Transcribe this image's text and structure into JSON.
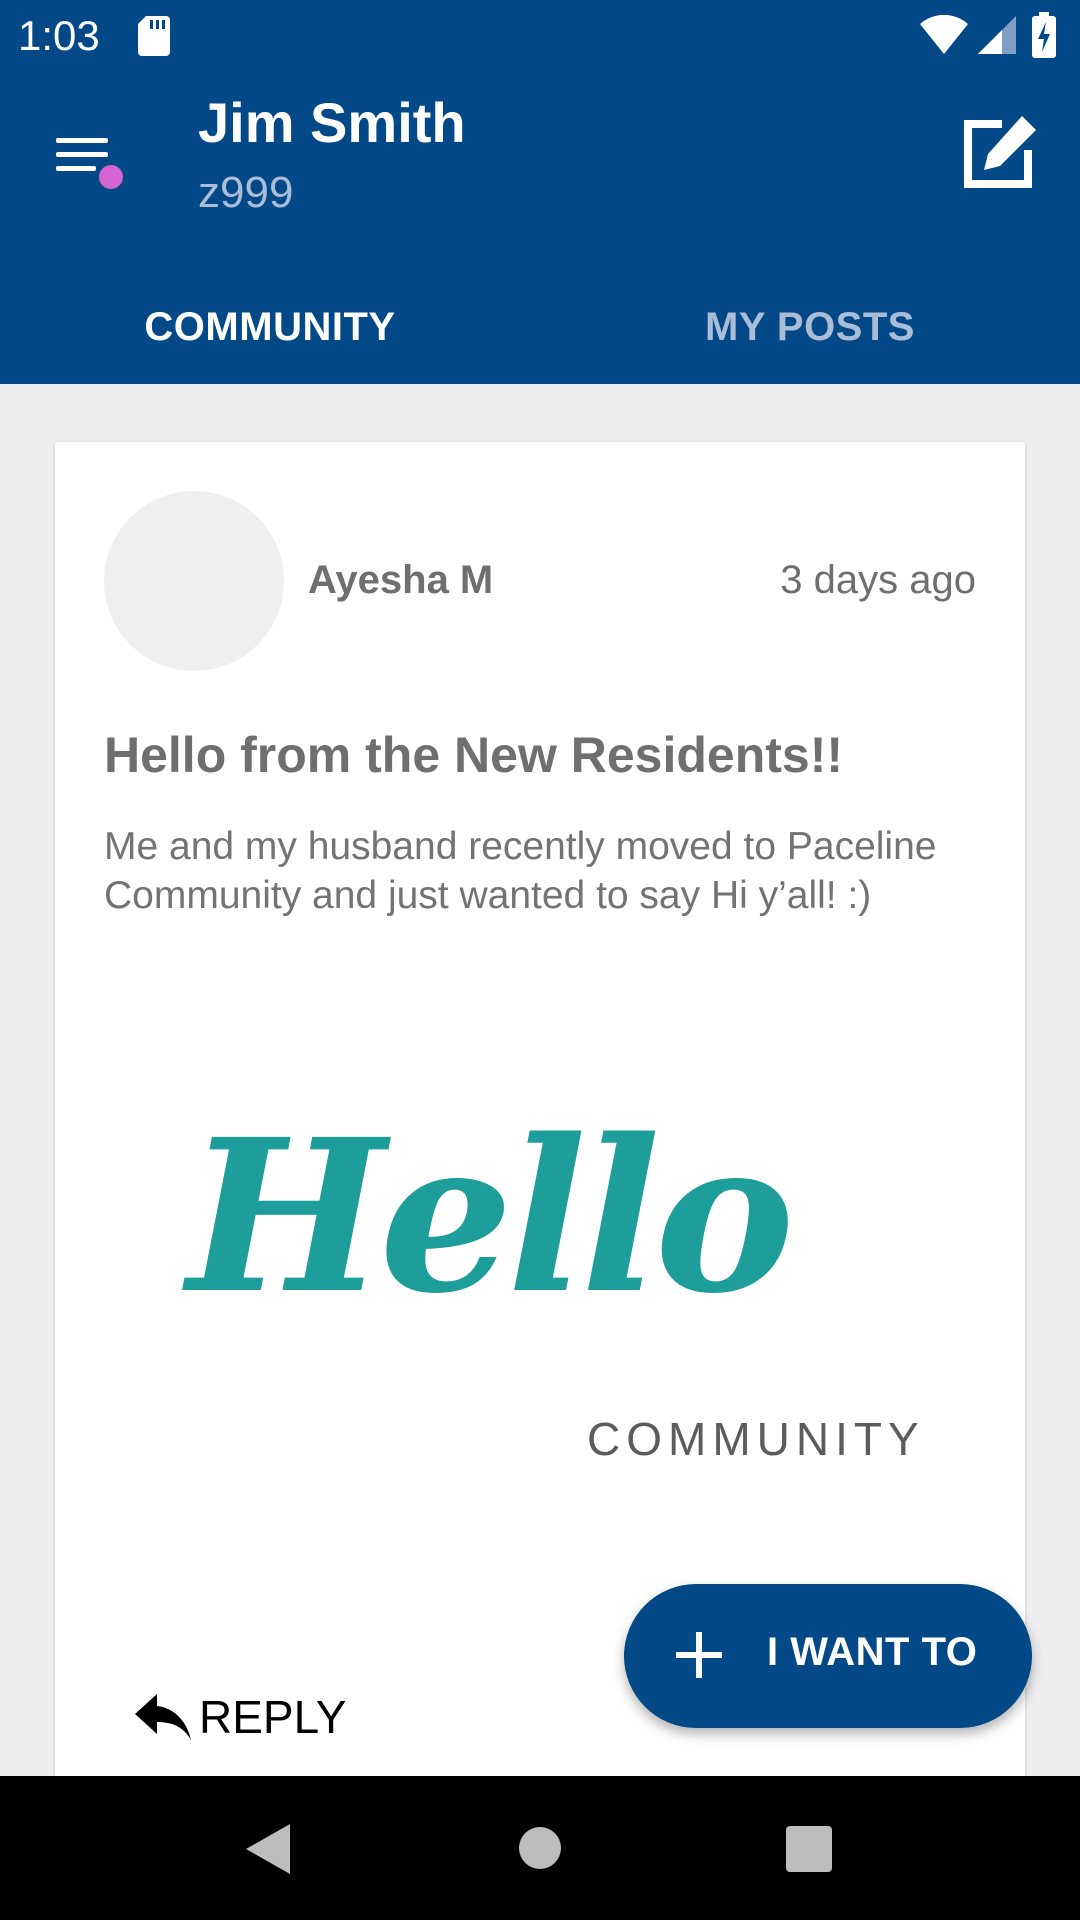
{
  "status_bar": {
    "time": "1:03",
    "icons": [
      "sd-card-icon",
      "wifi-icon",
      "signal-icon",
      "battery-charging-icon"
    ]
  },
  "header": {
    "user_name": "Jim Smith",
    "user_id": "z999",
    "menu_icon": "hamburger-menu-icon",
    "compose_icon": "compose-edit-icon",
    "notification_dot_color": "#d464d0",
    "background_color": "#034887"
  },
  "tabs": [
    {
      "label": "COMMUNITY",
      "selected": true
    },
    {
      "label": "MY POSTS",
      "selected": false
    }
  ],
  "post": {
    "author": "Ayesha M",
    "time": "3 days ago",
    "title": "Hello from the New Residents!!",
    "body": "Me and my husband recently moved to Paceline Community and just wanted to say Hi y’all! :)",
    "image": {
      "word": "Hello",
      "subtitle": "COMMUNITY"
    },
    "reply_label": "REPLY",
    "reply_icon": "reply-arrow-icon"
  },
  "fab": {
    "label": "I WANT TO",
    "icon": "plus-icon"
  },
  "nav_bar": {
    "icons": [
      "back-icon",
      "home-icon",
      "recents-icon"
    ]
  }
}
